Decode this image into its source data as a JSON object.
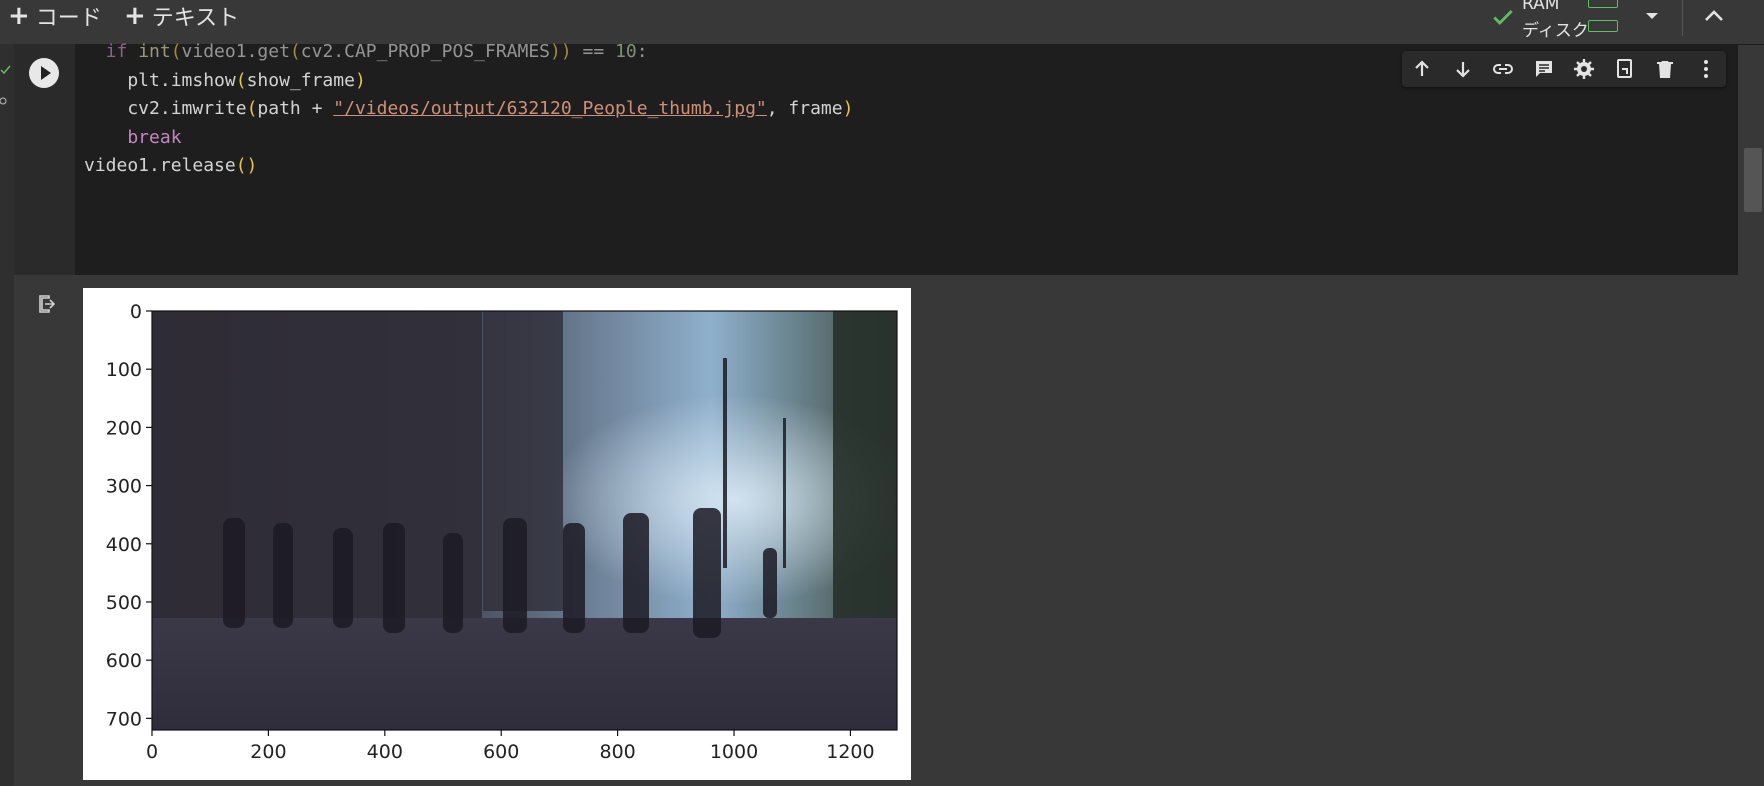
{
  "toolbar": {
    "add_code_label": "コード",
    "add_text_label": "テキスト",
    "plus": "+",
    "ram_label": "RAM",
    "disk_label": "ディスク",
    "status_color": "#5cc15c"
  },
  "code_lines": [
    {
      "parts": [
        {
          "t": "  if ",
          "c": "kw"
        },
        {
          "t": "int",
          "c": "fn"
        },
        {
          "t": "(",
          "c": "par"
        },
        {
          "t": "video1.get",
          "c": ""
        },
        {
          "t": "(",
          "c": "par"
        },
        {
          "t": "cv2.CAP_PROP_POS_FRAMES",
          "c": ""
        },
        {
          "t": "))",
          "c": "par"
        },
        {
          "t": " == ",
          "c": ""
        },
        {
          "t": "10",
          "c": "num"
        },
        {
          "t": ":",
          "c": ""
        }
      ],
      "faded": true
    },
    {
      "parts": [
        {
          "t": "    plt.imshow",
          "c": ""
        },
        {
          "t": "(",
          "c": "par"
        },
        {
          "t": "show_frame",
          "c": ""
        },
        {
          "t": ")",
          "c": "par"
        }
      ]
    },
    {
      "parts": [
        {
          "t": "    cv2.imwrite",
          "c": ""
        },
        {
          "t": "(",
          "c": "par"
        },
        {
          "t": "path + ",
          "c": ""
        },
        {
          "t": "\"/videos/output/632120_People_thumb.jpg\"",
          "c": "str"
        },
        {
          "t": ", frame",
          "c": ""
        },
        {
          "t": ")",
          "c": "par"
        }
      ]
    },
    {
      "parts": [
        {
          "t": "    break",
          "c": "kw"
        }
      ]
    },
    {
      "parts": [
        {
          "t": "video1.release",
          "c": ""
        },
        {
          "t": "()",
          "c": "par"
        }
      ]
    }
  ],
  "cell_toolbar_icons": [
    "move-up-icon",
    "move-down-icon",
    "link-icon",
    "comment-icon",
    "settings-icon",
    "mirror-cell-icon",
    "delete-icon",
    "more-vert-icon"
  ],
  "plot": {
    "x_ticks": [
      "0",
      "200",
      "400",
      "600",
      "800",
      "1000",
      "1200"
    ],
    "y_ticks": [
      "0",
      "100",
      "200",
      "300",
      "400",
      "500",
      "600",
      "700"
    ],
    "x_range": [
      0,
      1280
    ],
    "y_range": [
      0,
      720
    ]
  }
}
